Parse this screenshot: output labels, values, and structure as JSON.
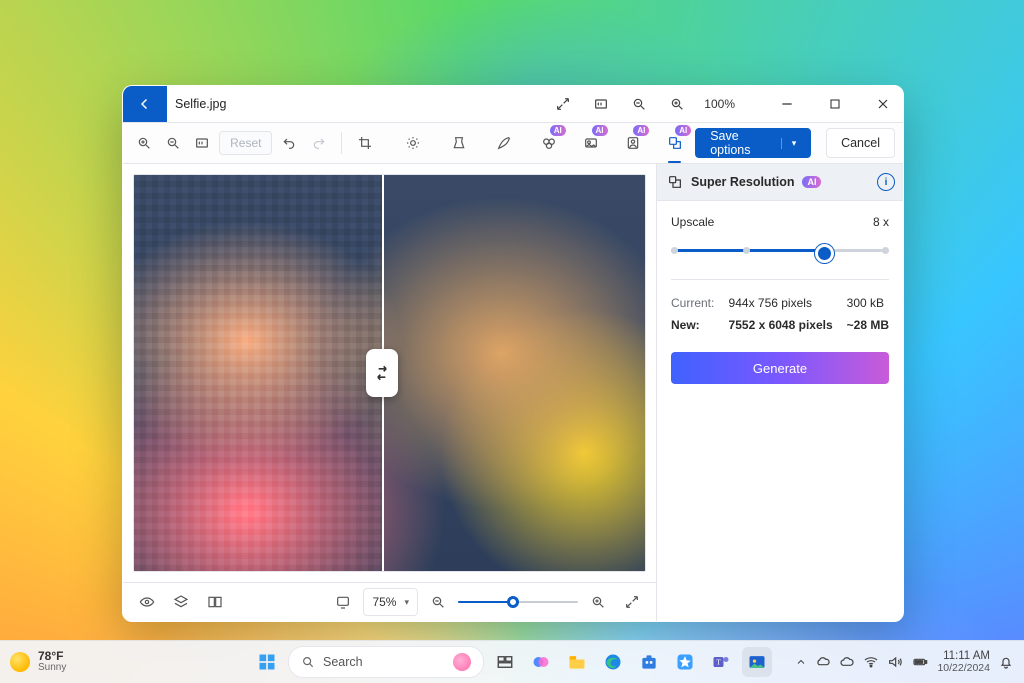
{
  "window": {
    "filename": "Selfie.jpg",
    "zoom_label": "100%"
  },
  "toolbar": {
    "reset": "Reset",
    "save_options": "Save options",
    "cancel": "Cancel",
    "ai": "AI"
  },
  "panel": {
    "title": "Super Resolution",
    "upscale_label": "Upscale",
    "upscale_value": "8 x",
    "current_label": "Current:",
    "current_dims": "944x 756 pixels",
    "current_size": "300 kB",
    "new_label": "New:",
    "new_dims": "7552 x 6048 pixels",
    "new_size": "~28 MB",
    "generate": "Generate"
  },
  "status": {
    "zoom": "75%"
  },
  "taskbar": {
    "search_placeholder": "Search",
    "weather": {
      "temp": "78°F",
      "cond": "Sunny"
    },
    "time": "11:11 AM",
    "date": "10/22/2024"
  }
}
